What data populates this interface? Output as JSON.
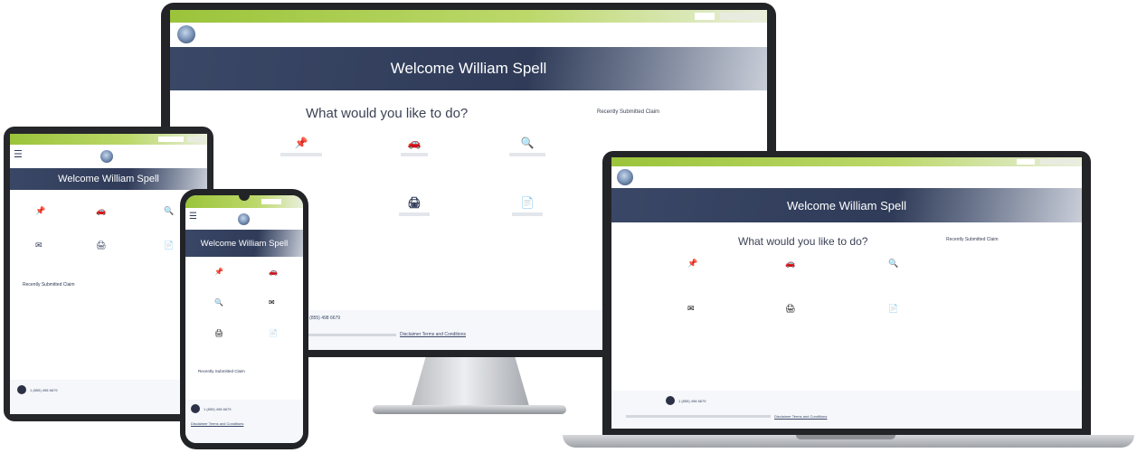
{
  "welcome": "Welcome William Spell",
  "prompt": "What would you like to do?",
  "recent_heading": "Recently Submitted Claim",
  "actions": [
    {
      "icon": "pin-icon",
      "glyph": "📌"
    },
    {
      "icon": "car-icon",
      "glyph": "🚗"
    },
    {
      "icon": "search-icon",
      "glyph": "🔍"
    },
    {
      "icon": "envelope-icon",
      "glyph": "✉"
    },
    {
      "icon": "print-icon",
      "glyph": "🖨"
    },
    {
      "icon": "document-icon",
      "glyph": "📄"
    }
  ],
  "phone_number": "1 (855) 498 6679",
  "footer_link": "Disclaimer Terms and Conditions",
  "colors": {
    "navy": "#2f3b58",
    "green": "#9bc43a",
    "icon": "#2f3a55"
  }
}
